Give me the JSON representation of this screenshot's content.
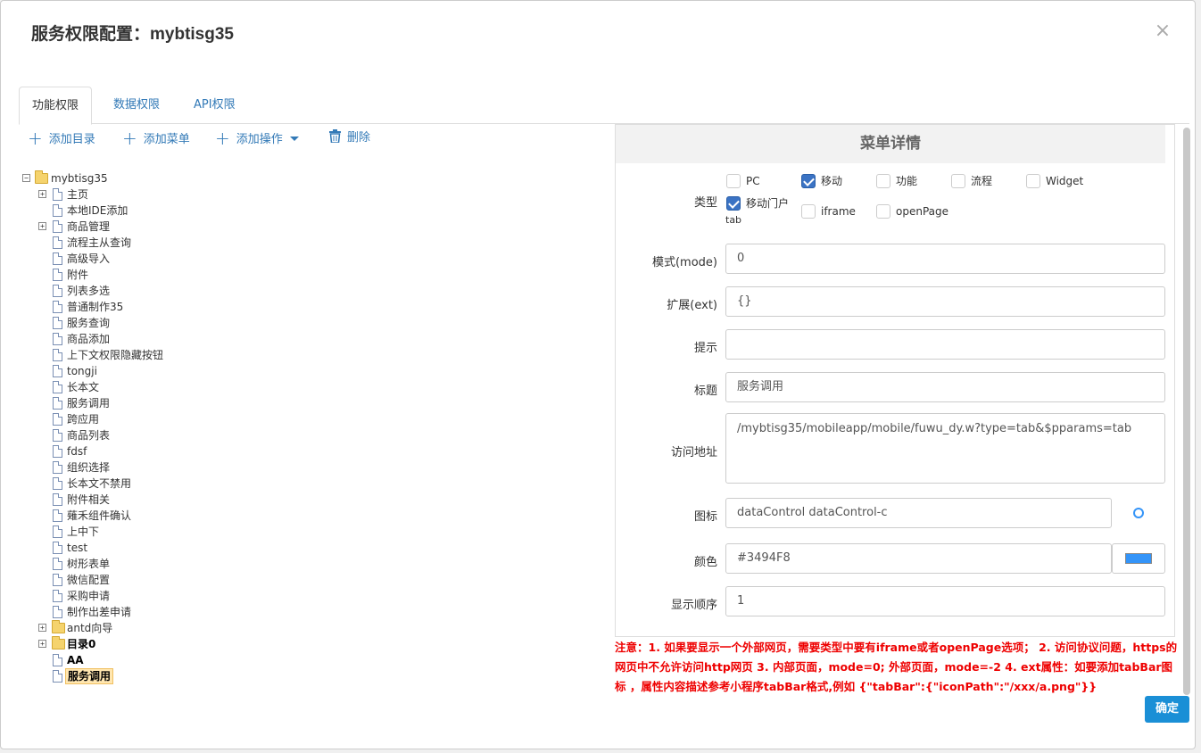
{
  "dialog": {
    "title": "服务权限配置：mybtisg35",
    "close_label": "×"
  },
  "tabs": [
    {
      "label": "功能权限",
      "active": true
    },
    {
      "label": "数据权限"
    },
    {
      "label": "API权限"
    }
  ],
  "toolbar": {
    "add_dir": "添加目录",
    "add_menu": "添加菜单",
    "add_action": "添加操作",
    "delete": "删除",
    "plus": "+"
  },
  "tree": {
    "root": "mybtisg35",
    "items": [
      "主页",
      "本地IDE添加",
      "商品管理",
      "流程主从查询",
      "高级导入",
      "附件",
      "列表多选",
      "普通制作35",
      "服务查询",
      "商品添加",
      "上下文权限隐藏按钮",
      "tongji",
      "长本文",
      "服务调用",
      "跨应用",
      "商品列表",
      "fdsf",
      "组织选择",
      "长本文不禁用",
      "附件相关",
      "薙禾组件确认",
      "上中下",
      "test",
      "树形表单",
      "微信配置",
      "采购申请",
      "制作出差申请",
      "antd向导",
      "目录0",
      "AA",
      "服务调用"
    ],
    "expander_plus": "+",
    "expander_minus": "−"
  },
  "panel": {
    "header": "菜单详情",
    "type_label": "类型",
    "type_options": [
      {
        "label": "PC",
        "checked": false
      },
      {
        "label": "移动",
        "checked": true
      },
      {
        "label": "功能",
        "checked": false
      },
      {
        "label": "流程",
        "checked": false
      },
      {
        "label": "Widget",
        "checked": false
      },
      {
        "label": "移动门户",
        "checked": true
      },
      {
        "label": "iframe",
        "checked": false
      },
      {
        "label": "openPage",
        "checked": false
      }
    ],
    "type_tab_suffix": "tab",
    "mode_label": "模式(mode)",
    "mode_value": "0",
    "ext_label": "扩展(ext)",
    "ext_value": "{}",
    "tip_label": "提示",
    "tip_value": "",
    "title_label": "标题",
    "title_value": "服务调用",
    "url_label": "访问地址",
    "url_value": "/mybtisg35/mobileapp/mobile/fuwu_dy.w?type=tab&$pparams=tab",
    "icon_label": "图标",
    "icon_value": "dataControl dataControl-c",
    "color_label": "颜色",
    "color_value": "#3494F8",
    "order_label": "显示顺序",
    "order_value": "1"
  },
  "note": "注意：1. 如果要显示一个外部网页，需要类型中要有iframe或者openPage选项； 2. 访问协议问题，https的网页中不允许访问http网页 3. 内部页面，mode=0; 外部页面，mode=-2 4. ext属性：如要添加tabBar图标 ，属性内容描述参考小程序tabBar格式,例如 {\"tabBar\":{\"iconPath\":\"/xxx/a.png\"}}",
  "ok_label": "确定",
  "colors": {
    "accent": "#337ab7",
    "swatch": "#3494F8",
    "note": "#ee0000",
    "ok": "#1a8fd6"
  }
}
